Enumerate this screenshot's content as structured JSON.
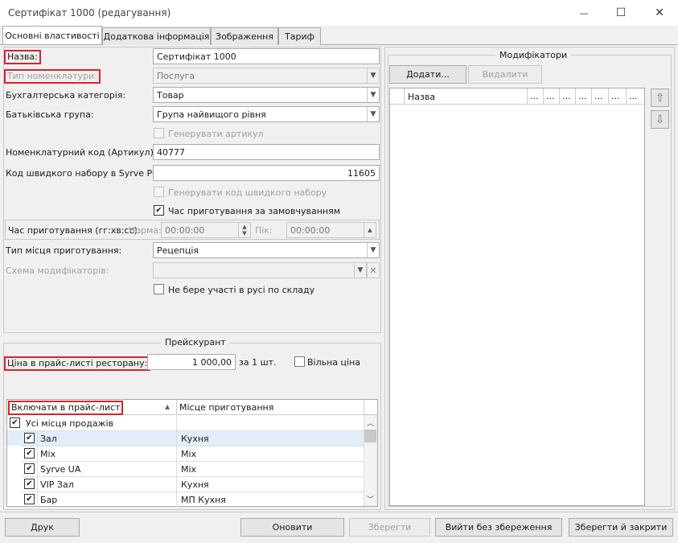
{
  "window": {
    "title": "Сертифікат 1000 (редагування)",
    "minimize": "—",
    "maximize": "☐",
    "close": "✕"
  },
  "tabs": [
    "Основні властивості",
    "Додаткова інформація",
    "Зображення",
    "Тариф"
  ],
  "form": {
    "name_label": "Назва:",
    "name_value": "Сертифікат 1000",
    "type_label": "Тип номенклатури:",
    "type_value": "Послуга",
    "accounting_label": "Бухгалтерська категорія:",
    "accounting_value": "Товар",
    "parent_label": "Батьківська група:",
    "parent_value": "Група найвищого рівня",
    "gen_article_label": "Генерувати артикул",
    "code_label": "Номенклатурний код (Артикул):",
    "code_value": "40777",
    "fastcode_label": "Код швидкого набору в Syrve POS:",
    "fastcode_value": "11605",
    "gen_fastcode_label": "Генерувати код швидкого набору",
    "default_time_label": "Час приготування за замовчуванням",
    "cook_time_label": "Час приготування (гг:хв:сс):",
    "norm_label": "Норма:",
    "norm_value": "00:00:00",
    "peak_label": "Пік:",
    "peak_value": "00:00:00",
    "place_label": "Тип місця приготування:",
    "place_value": "Рецепція",
    "modscheme_label": "Схема модифікаторів:",
    "no_stock_label": "Не бере участі в русі по складу"
  },
  "pricelist": {
    "title": "Прейскурант",
    "price_label": "Ціна в прайс-листі ресторану:",
    "price_value": "1 000,00",
    "per_unit": "за 1 шт.",
    "free_price_label": "Вільна ціна",
    "col_include": "Включати в прайс-лист",
    "col_place": "Місце приготування",
    "all_places": "Усі місця продажів",
    "rows": [
      {
        "name": "Зал",
        "place": "Кухня"
      },
      {
        "name": "Mix",
        "place": "Mix"
      },
      {
        "name": "Syrve UA",
        "place": "Mix"
      },
      {
        "name": "VIP Зал",
        "place": "Кухня"
      },
      {
        "name": "Бар",
        "place": "МП Кухня"
      }
    ]
  },
  "modifiers": {
    "title": "Модифікатори",
    "add_button": "Додати...",
    "delete_button": "Видалити",
    "col_name": "Назва",
    "col_more": "..."
  },
  "footer": {
    "print": "Друк",
    "update": "Оновити",
    "save": "Зберегти",
    "exit": "Вийти без збереження",
    "save_close": "Зберегти й закрити"
  }
}
